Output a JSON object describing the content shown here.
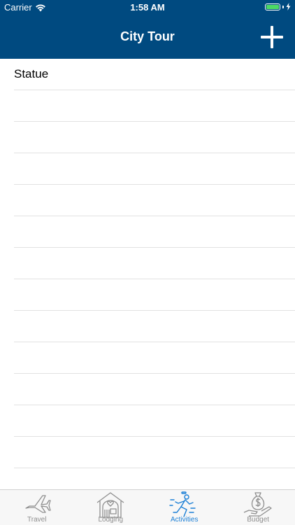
{
  "status_bar": {
    "carrier": "Carrier",
    "time": "1:58 AM",
    "battery_color": "#4cd964"
  },
  "nav": {
    "title": "City Tour",
    "add_icon": "plus-icon"
  },
  "list": {
    "items": [
      {
        "label": "Statue"
      },
      {
        "label": ""
      },
      {
        "label": ""
      },
      {
        "label": ""
      },
      {
        "label": ""
      },
      {
        "label": ""
      },
      {
        "label": ""
      },
      {
        "label": ""
      },
      {
        "label": ""
      },
      {
        "label": ""
      },
      {
        "label": ""
      },
      {
        "label": ""
      },
      {
        "label": ""
      },
      {
        "label": ""
      }
    ]
  },
  "tabbar": {
    "active_color": "#1a7fd6",
    "inactive_color": "#8e8e8e",
    "tabs": [
      {
        "label": "Travel",
        "icon": "airplane-icon"
      },
      {
        "label": "Lodging",
        "icon": "house-icon"
      },
      {
        "label": "Activities",
        "icon": "running-person-icon",
        "active": true
      },
      {
        "label": "Budget",
        "icon": "money-bag-hand-icon"
      }
    ]
  },
  "colors": {
    "header": "#004a80"
  }
}
